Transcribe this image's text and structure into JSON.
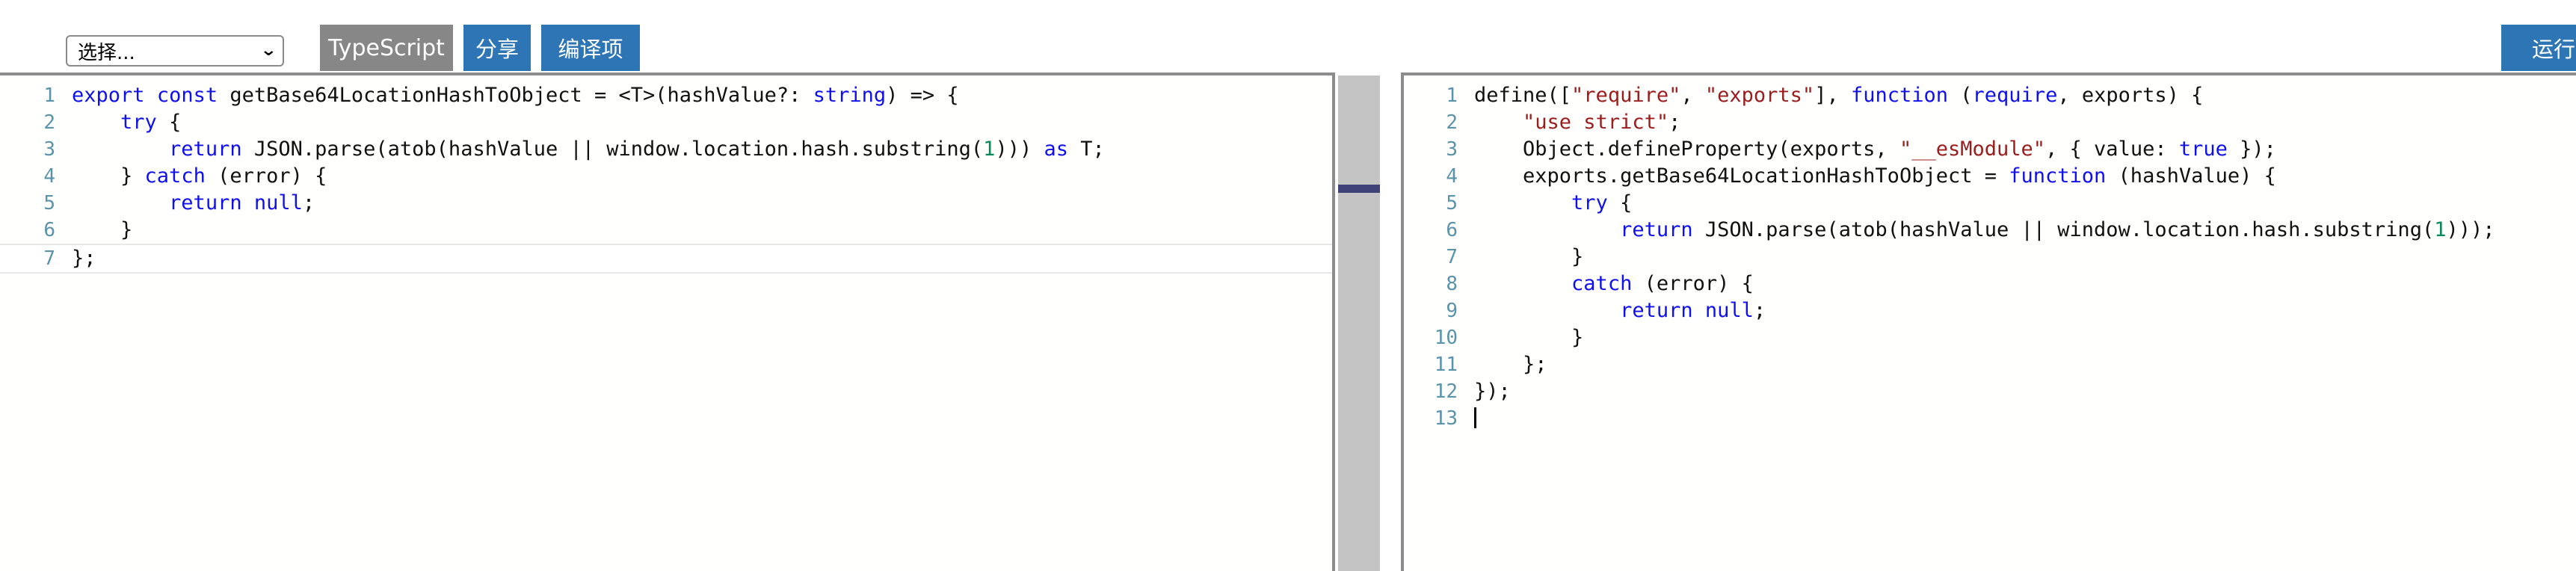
{
  "toolbar": {
    "select": {
      "value": "选择...",
      "chevron": "chevron-down-icon",
      "chevron_glyph": "⌄"
    },
    "language_button": "TypeScript",
    "share_button": "分享",
    "compiler_options_button": "编译项",
    "run_button": "运行"
  },
  "left_editor": {
    "language": "TypeScript",
    "current_line": 7,
    "lines": [
      {
        "n": "1",
        "tokens": [
          {
            "t": "export",
            "c": "kw"
          },
          {
            "t": " ",
            "c": "pl"
          },
          {
            "t": "const",
            "c": "kw"
          },
          {
            "t": " getBase64LocationHashToObject = <T>(hashValue?: ",
            "c": "pl"
          },
          {
            "t": "string",
            "c": "kw"
          },
          {
            "t": ") => {",
            "c": "pl"
          }
        ]
      },
      {
        "n": "2",
        "tokens": [
          {
            "t": "    ",
            "c": "pl"
          },
          {
            "t": "try",
            "c": "kw"
          },
          {
            "t": " {",
            "c": "pl"
          }
        ]
      },
      {
        "n": "3",
        "tokens": [
          {
            "t": "        ",
            "c": "pl"
          },
          {
            "t": "return",
            "c": "kw"
          },
          {
            "t": " JSON.parse(atob(hashValue || window.location.hash.substring(",
            "c": "pl"
          },
          {
            "t": "1",
            "c": "num"
          },
          {
            "t": "))) ",
            "c": "pl"
          },
          {
            "t": "as",
            "c": "kw"
          },
          {
            "t": " T;",
            "c": "pl"
          }
        ]
      },
      {
        "n": "4",
        "tokens": [
          {
            "t": "    } ",
            "c": "pl"
          },
          {
            "t": "catch",
            "c": "kw"
          },
          {
            "t": " (error) {",
            "c": "pl"
          }
        ]
      },
      {
        "n": "5",
        "tokens": [
          {
            "t": "        ",
            "c": "pl"
          },
          {
            "t": "return",
            "c": "kw"
          },
          {
            "t": " ",
            "c": "pl"
          },
          {
            "t": "null",
            "c": "kw"
          },
          {
            "t": ";",
            "c": "pl"
          }
        ]
      },
      {
        "n": "6",
        "tokens": [
          {
            "t": "    }",
            "c": "pl"
          }
        ]
      },
      {
        "n": "7",
        "tokens": [
          {
            "t": "};",
            "c": "pl"
          }
        ]
      }
    ]
  },
  "right_editor": {
    "language": "JavaScript",
    "cursor_line": 13,
    "lines": [
      {
        "n": "1",
        "tokens": [
          {
            "t": "define([",
            "c": "pl"
          },
          {
            "t": "\"require\"",
            "c": "str"
          },
          {
            "t": ", ",
            "c": "pl"
          },
          {
            "t": "\"exports\"",
            "c": "str"
          },
          {
            "t": "], ",
            "c": "pl"
          },
          {
            "t": "function",
            "c": "kw"
          },
          {
            "t": " (",
            "c": "pl"
          },
          {
            "t": "require",
            "c": "kw"
          },
          {
            "t": ", exports) {",
            "c": "pl"
          }
        ]
      },
      {
        "n": "2",
        "tokens": [
          {
            "t": "    ",
            "c": "pl"
          },
          {
            "t": "\"use strict\"",
            "c": "str"
          },
          {
            "t": ";",
            "c": "pl"
          }
        ]
      },
      {
        "n": "3",
        "tokens": [
          {
            "t": "    Object.defineProperty(exports, ",
            "c": "pl"
          },
          {
            "t": "\"__esModule\"",
            "c": "str"
          },
          {
            "t": ", { value: ",
            "c": "pl"
          },
          {
            "t": "true",
            "c": "kw"
          },
          {
            "t": " });",
            "c": "pl"
          }
        ]
      },
      {
        "n": "4",
        "tokens": [
          {
            "t": "    exports.getBase64LocationHashToObject = ",
            "c": "pl"
          },
          {
            "t": "function",
            "c": "kw"
          },
          {
            "t": " (hashValue) {",
            "c": "pl"
          }
        ]
      },
      {
        "n": "5",
        "tokens": [
          {
            "t": "        ",
            "c": "pl"
          },
          {
            "t": "try",
            "c": "kw"
          },
          {
            "t": " {",
            "c": "pl"
          }
        ]
      },
      {
        "n": "6",
        "tokens": [
          {
            "t": "            ",
            "c": "pl"
          },
          {
            "t": "return",
            "c": "kw"
          },
          {
            "t": " JSON.parse(atob(hashValue || window.location.hash.substring(",
            "c": "pl"
          },
          {
            "t": "1",
            "c": "num"
          },
          {
            "t": ")));",
            "c": "pl"
          }
        ]
      },
      {
        "n": "7",
        "tokens": [
          {
            "t": "        }",
            "c": "pl"
          }
        ]
      },
      {
        "n": "8",
        "tokens": [
          {
            "t": "        ",
            "c": "pl"
          },
          {
            "t": "catch",
            "c": "kw"
          },
          {
            "t": " (error) {",
            "c": "pl"
          }
        ]
      },
      {
        "n": "9",
        "tokens": [
          {
            "t": "            ",
            "c": "pl"
          },
          {
            "t": "return",
            "c": "kw"
          },
          {
            "t": " ",
            "c": "pl"
          },
          {
            "t": "null",
            "c": "kw"
          },
          {
            "t": ";",
            "c": "pl"
          }
        ]
      },
      {
        "n": "10",
        "tokens": [
          {
            "t": "        }",
            "c": "pl"
          }
        ]
      },
      {
        "n": "11",
        "tokens": [
          {
            "t": "    };",
            "c": "pl"
          }
        ]
      },
      {
        "n": "12",
        "tokens": [
          {
            "t": "});",
            "c": "pl"
          }
        ]
      },
      {
        "n": "13",
        "tokens": []
      }
    ]
  },
  "scrollbar": {
    "name": "vertical-scrollbar",
    "marker_present": true
  },
  "colors": {
    "accent_blue": "#2e75b6",
    "neutral_gray": "#878787",
    "keyword": "#1010ee",
    "string": "#9b1c1c",
    "number": "#09885a",
    "line_number": "#5b93ab",
    "border": "#8c8c8c",
    "scrollbar_track": "#c4c4c4",
    "scrollbar_marker": "#3f4278"
  }
}
